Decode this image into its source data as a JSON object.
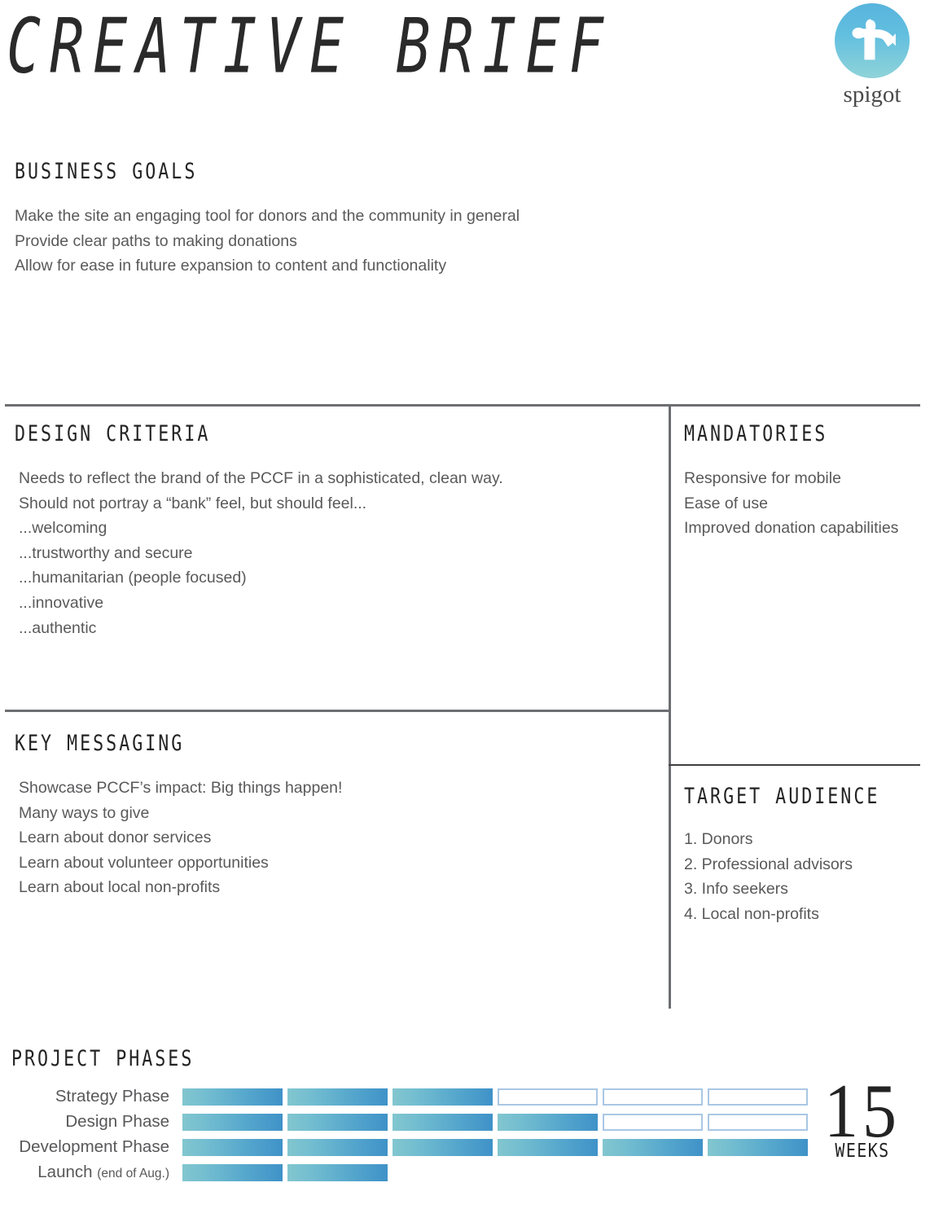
{
  "header": {
    "title": "CREATIVE BRIEF",
    "logo": {
      "icon": "spigot-faucet-icon",
      "wordmark": "spigot",
      "gradient_top": "#58b4dd",
      "gradient_bottom": "#8fd3d9"
    }
  },
  "business_goals": {
    "heading": "BUSINESS GOALS",
    "items": [
      "Make the site an engaging tool for donors and the community in general",
      "Provide clear paths to making donations",
      "Allow for ease in future expansion to content and functionality"
    ]
  },
  "design_criteria": {
    "heading": "DESIGN CRITERIA",
    "items": [
      "Needs to reflect the brand of the PCCF in a sophisticated, clean way.",
      "Should not portray a “bank” feel, but should feel...",
      "...welcoming",
      "...trustworthy and secure",
      "...humanitarian (people focused)",
      "...innovative",
      "...authentic"
    ]
  },
  "key_messaging": {
    "heading": "KEY MESSAGING",
    "items": [
      "Showcase PCCF’s impact: Big things happen!",
      "Many ways to give",
      "Learn about donor services",
      "Learn about volunteer opportunities",
      "Learn about local non-profits"
    ]
  },
  "mandatories": {
    "heading": "MANDATORIES",
    "items": [
      "Responsive for mobile",
      "Ease of use",
      "Improved donation capabilities"
    ]
  },
  "target_audience": {
    "heading": "TARGET AUDIENCE",
    "items": [
      "1. Donors",
      "2. Professional advisors",
      "3. Info seekers",
      "4. Local non-profits"
    ]
  },
  "project_phases": {
    "heading": "PROJECT PHASES",
    "duration_number": "15",
    "duration_unit": "WEEKS",
    "colors": {
      "bar_gradient_start": "#82c6cf",
      "bar_gradient_end": "#3f92c8",
      "empty_cell_border": "#a9c7e4"
    }
  },
  "chart_data": {
    "type": "bar",
    "title": "PROJECT PHASES",
    "xlabel": "",
    "ylabel": "",
    "total_units": 6,
    "unit_name": "segment",
    "total_duration": "15 WEEKS",
    "categories": [
      "Strategy Phase",
      "Design Phase",
      "Development Phase",
      "Launch (end of Aug.)"
    ],
    "values": [
      3,
      4,
      6,
      2
    ],
    "series": [
      {
        "name": "Strategy Phase",
        "label": "Strategy Phase",
        "label_sub": "",
        "filled": 3,
        "outlined": 3,
        "blank": 0,
        "cells": [
          "filled",
          "filled",
          "filled",
          "empty",
          "empty",
          "empty"
        ]
      },
      {
        "name": "Design Phase",
        "label": "Design Phase",
        "label_sub": "",
        "filled": 4,
        "outlined": 2,
        "blank": 0,
        "cells": [
          "filled",
          "filled",
          "filled",
          "filled",
          "empty",
          "empty"
        ]
      },
      {
        "name": "Development Phase",
        "label": "Development Phase",
        "label_sub": "",
        "filled": 6,
        "outlined": 0,
        "blank": 0,
        "cells": [
          "filled",
          "filled",
          "filled",
          "filled",
          "filled",
          "filled"
        ]
      },
      {
        "name": "Launch",
        "label": "Launch ",
        "label_sub": "(end of Aug.)",
        "filled": 2,
        "outlined": 0,
        "blank": 4,
        "cells": [
          "filled",
          "filled",
          "blank",
          "blank",
          "blank",
          "blank"
        ]
      }
    ],
    "grid": false,
    "legend": "none"
  }
}
